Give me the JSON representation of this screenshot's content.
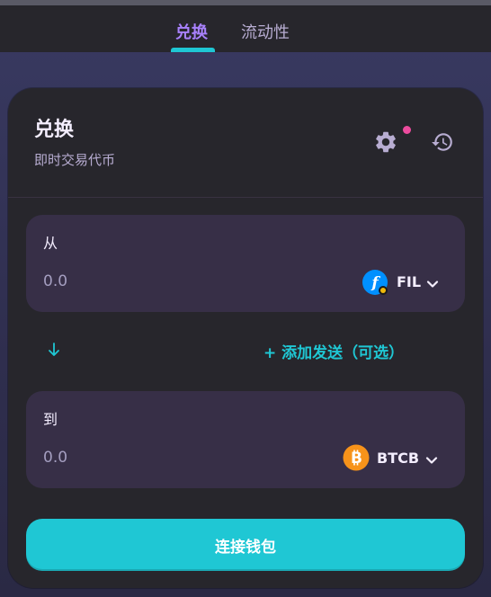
{
  "tabs": [
    {
      "label": "兑换",
      "active": true
    },
    {
      "label": "流动性",
      "active": false
    }
  ],
  "card": {
    "title": "兑换",
    "subtitle": "即时交易代币",
    "settings_icon": "gear-icon",
    "history_icon": "history-icon",
    "notification_dot_color": "#ed4b9e"
  },
  "from": {
    "label": "从",
    "amount": "0.0",
    "token": {
      "symbol": "FIL",
      "icon": "filecoin-icon",
      "color": "#0090ff"
    }
  },
  "to": {
    "label": "到",
    "amount": "0.0",
    "token": {
      "symbol": "BTCB",
      "icon": "bitcoin-icon",
      "color": "#f7931a"
    }
  },
  "switch_icon": "arrow-down-icon",
  "add_send_label": "+ 添加发送（可选）",
  "connect_wallet_label": "连接钱包",
  "colors": {
    "accent": "#1fc7d4",
    "active_tab": "#a881fc",
    "card_bg": "#27262c",
    "input_bg": "#372f47"
  }
}
